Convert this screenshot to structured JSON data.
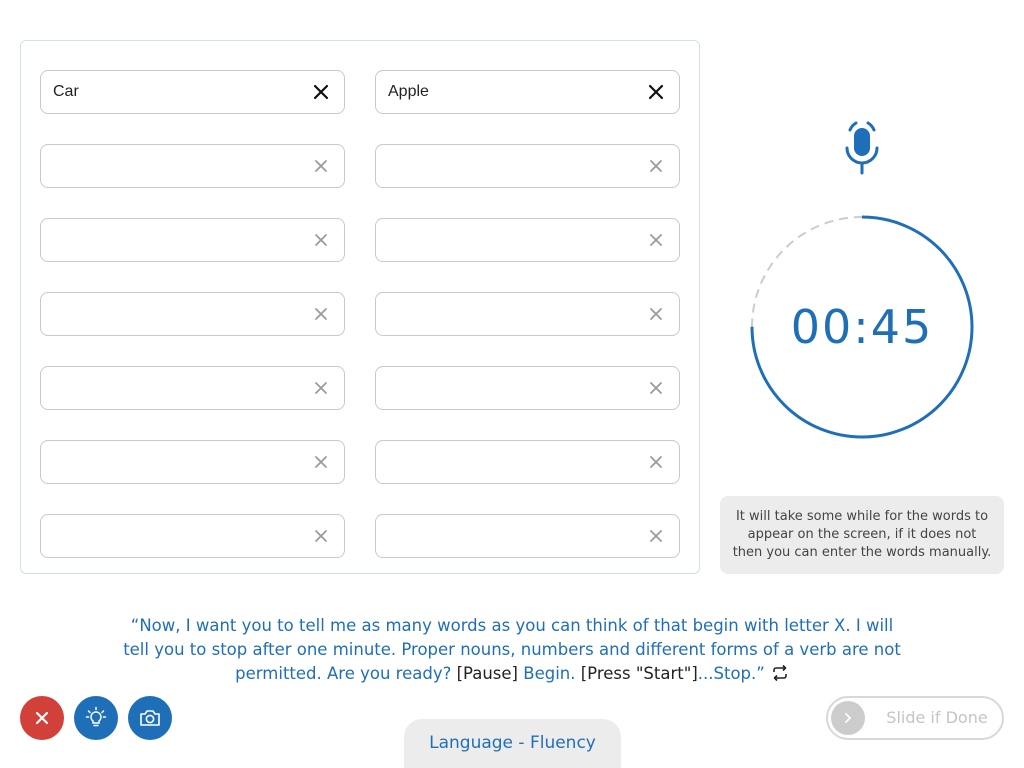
{
  "word_fields": {
    "left": [
      {
        "value": "Car"
      },
      {
        "value": ""
      },
      {
        "value": ""
      },
      {
        "value": ""
      },
      {
        "value": ""
      },
      {
        "value": ""
      },
      {
        "value": ""
      }
    ],
    "right": [
      {
        "value": "Apple"
      },
      {
        "value": ""
      },
      {
        "value": ""
      },
      {
        "value": ""
      },
      {
        "value": ""
      },
      {
        "value": ""
      },
      {
        "value": ""
      }
    ]
  },
  "timer": {
    "display": "00:45",
    "elapsed_fraction": 0.75
  },
  "info": {
    "text": "It will take some while for the words to appear on the screen, if it does not then you can enter the words manually."
  },
  "instruction": {
    "part1": "“Now, I want you to tell me as many words as you can think of that begin with letter X. I will tell you to stop after one minute. Proper nouns, numbers and different forms of a verb are not permitted. Are you ready? ",
    "pause": "[Pause]",
    "begin": " Begin. ",
    "press_start": "[Press \"Start\"]",
    "stop": "...Stop.”"
  },
  "section_tab": {
    "label": "Language - Fluency"
  },
  "slider": {
    "label": "Slide if Done"
  },
  "icons": {
    "mic": "microphone-icon",
    "clear": "close-x-icon",
    "repeat": "repeat-icon",
    "close": "close-icon",
    "hint": "lightbulb-icon",
    "camera": "camera-icon",
    "slider_arrow": "chevron-right-icon"
  },
  "colors": {
    "accent": "#1f6fb8",
    "danger": "#d2403a",
    "panel_border": "#cfe0ef",
    "muted": "#ececec"
  }
}
